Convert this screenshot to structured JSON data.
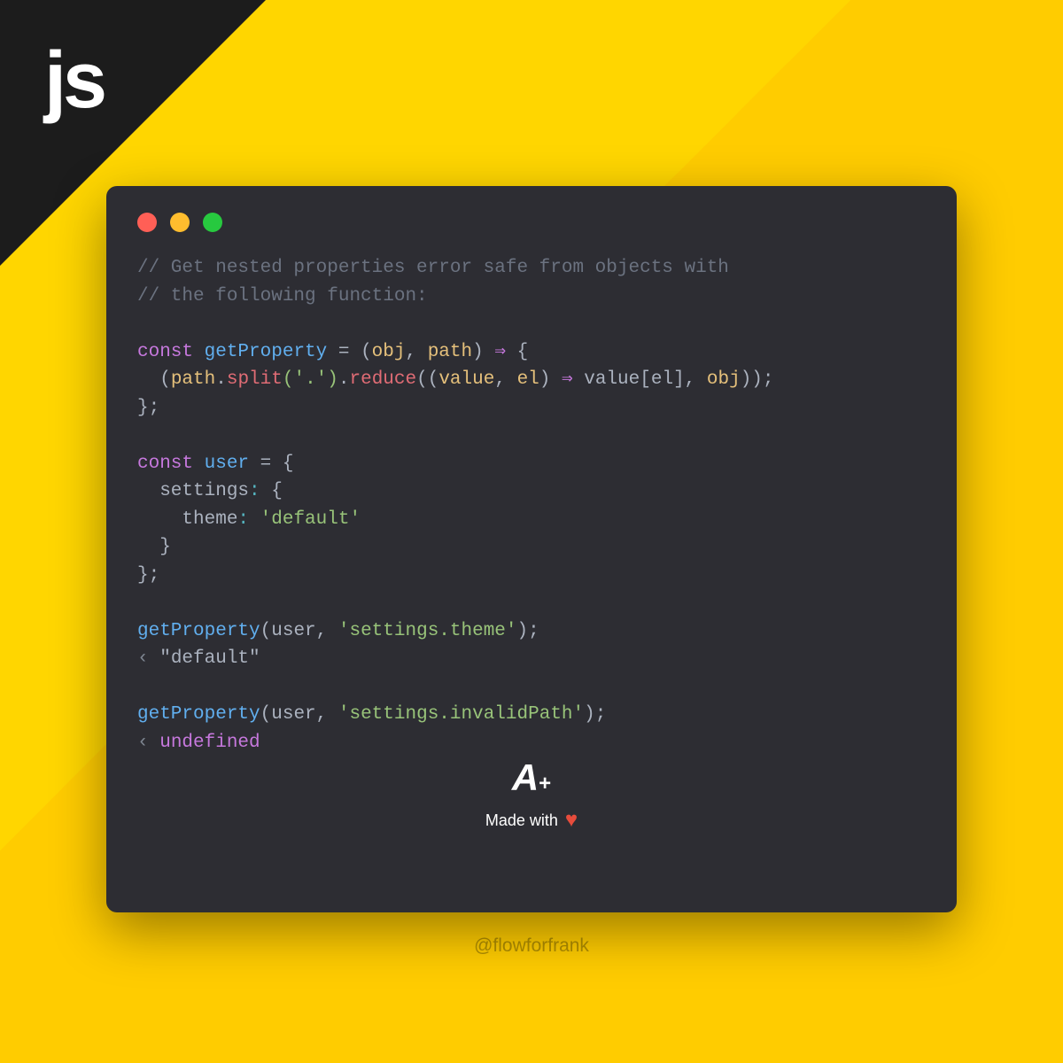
{
  "logo": "js",
  "code": {
    "comment1": "// Get nested properties error safe from objects with",
    "comment2": "// the following function:",
    "line1_const": "const",
    "line1_fn": "getProperty",
    "line1_eq": " = ",
    "line1_open": "(",
    "line1_param1": "obj",
    "line1_comma": ", ",
    "line1_param2": "path",
    "line1_close": ")",
    "line1_arrow": " ⇒ ",
    "line1_brace": "{",
    "line2_indent": "  (",
    "line2_path": "path",
    "line2_dot1": ".",
    "line2_split": "split",
    "line2_splitarg": "('.')",
    "line2_dot2": ".",
    "line2_reduce": "reduce",
    "line2_ropen": "((",
    "line2_value": "value",
    "line2_comma1": ", ",
    "line2_el": "el",
    "line2_rclose": ")",
    "line2_arrow": " ⇒ ",
    "line2_valueel": "value[el]",
    "line2_comma2": ", ",
    "line2_obj": "obj",
    "line2_end": "));",
    "line3": "};",
    "line5_const": "const",
    "line5_user": " user",
    "line5_rest": " = {",
    "line6": "  settings",
    "line6_colon": ": ",
    "line6_brace": "{",
    "line7": "    theme",
    "line7_colon": ": ",
    "line7_val": "'default'",
    "line8": "  }",
    "line9": "};",
    "line11_fn": "getProperty",
    "line11_open": "(",
    "line11_user": "user",
    "line11_comma": ", ",
    "line11_str": "'settings.theme'",
    "line11_close": ");",
    "line12_arrow": "‹ ",
    "line12_result": "\"default\"",
    "line14_fn": "getProperty",
    "line14_open": "(",
    "line14_user": "user",
    "line14_comma": ", ",
    "line14_str": "'settings.invalidPath'",
    "line14_close": ");",
    "line15_arrow": "‹ ",
    "line15_result": "undefined"
  },
  "footer": {
    "made_with": "Made with",
    "logo_a": "A",
    "logo_plus": "+"
  },
  "attribution": "@flowforfrank"
}
